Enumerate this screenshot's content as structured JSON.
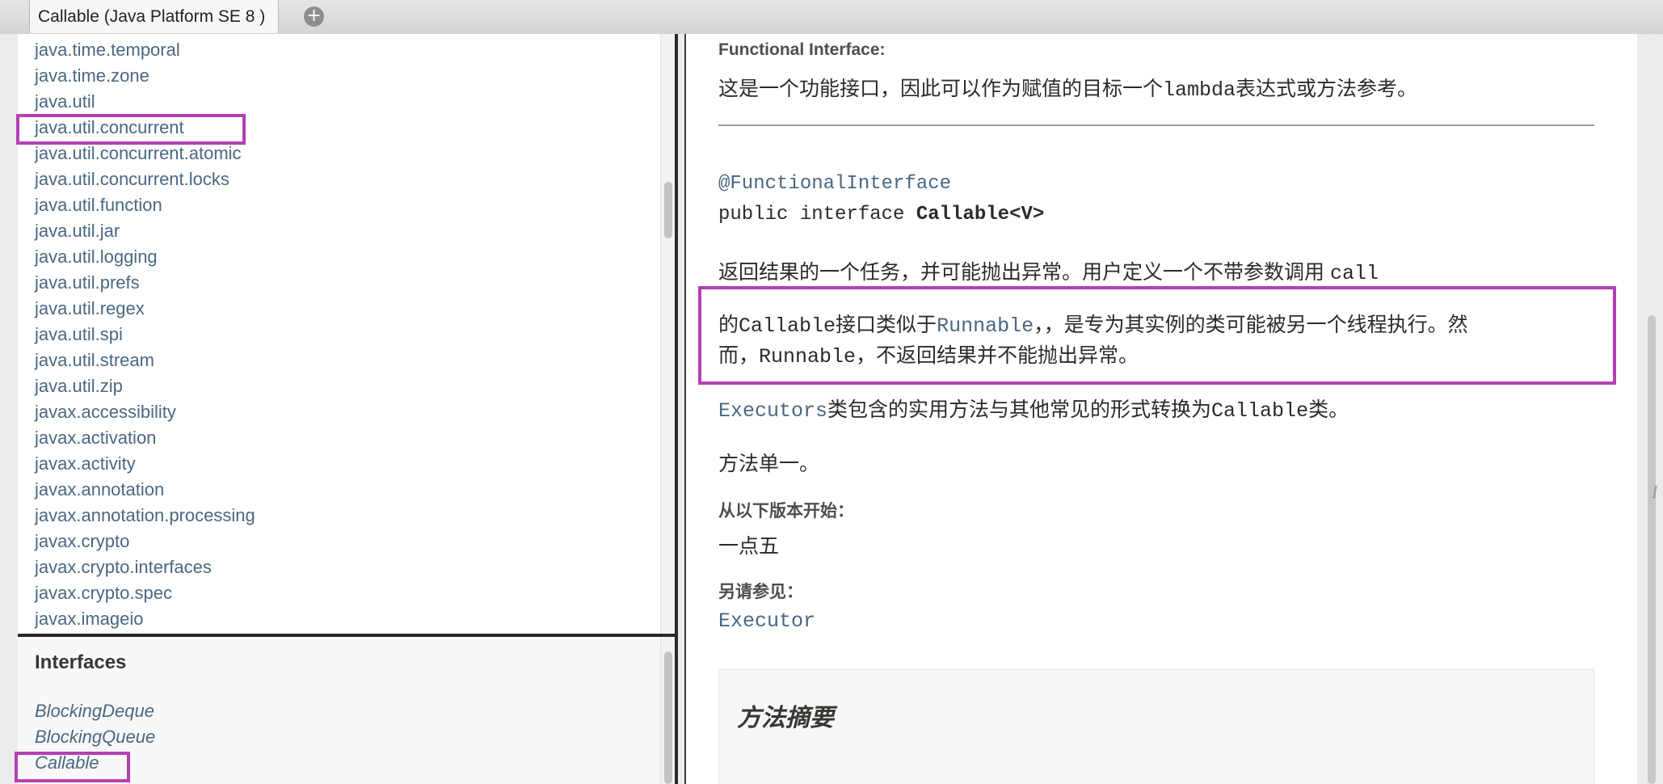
{
  "tab": {
    "title": "Callable (Java Platform SE 8 )",
    "new_tab_icon": "plus-circle-icon"
  },
  "packages": [
    "java.time.temporal",
    "java.time.zone",
    "java.util",
    "java.util.concurrent",
    "java.util.concurrent.atomic",
    "java.util.concurrent.locks",
    "java.util.function",
    "java.util.jar",
    "java.util.logging",
    "java.util.prefs",
    "java.util.regex",
    "java.util.spi",
    "java.util.stream",
    "java.util.zip",
    "javax.accessibility",
    "javax.activation",
    "javax.activity",
    "javax.annotation",
    "javax.annotation.processing",
    "javax.crypto",
    "javax.crypto.interfaces",
    "javax.crypto.spec",
    "javax.imageio"
  ],
  "classes": {
    "heading": "Interfaces",
    "items": [
      "BlockingDeque",
      "BlockingQueue",
      "Callable"
    ]
  },
  "content": {
    "functional_label": "Functional Interface:",
    "functional_text": "这是一个功能接口，因此可以作为赋值的目标一个",
    "functional_code": "lambda",
    "functional_text2": "表达式或方法参考。",
    "annotation": "@FunctionalInterface",
    "sig_prefix": "public interface ",
    "sig_name": "Callable<V>",
    "desc1_text": "返回结果的一个任务，并可能抛出异常。用户定义一个不带参数调用 ",
    "desc1_code": "call",
    "desc2_a": "的",
    "desc2_code1": "Callable",
    "desc2_b": "接口类似于",
    "desc2_link": "Runnable",
    "desc2_c": "，，是专为其实例的类可能被另一个线程执行。然",
    "desc3_a": "而，",
    "desc3_code": "Runnable",
    "desc3_b": "，不返回结果并不能抛出异常。",
    "desc4_link": "Executors",
    "desc4_a": "类包含的实用方法与其他常见的形式转换为",
    "desc4_code": "Callable",
    "desc4_b": "类。",
    "desc5": "方法单一。",
    "since_label": "从以下版本开始：",
    "since_value": "一点五",
    "see_label": "另请参见：",
    "see_link": "Executor",
    "summary_title": "方法摘要"
  },
  "colors": {
    "link": "#4a6782",
    "highlight": "#b53fb5"
  }
}
